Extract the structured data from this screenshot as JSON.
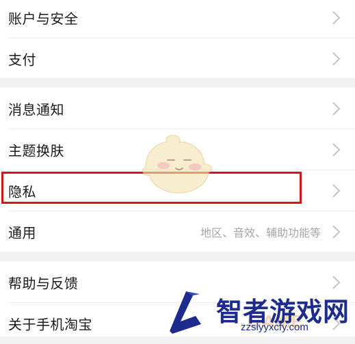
{
  "settings": {
    "items": [
      {
        "label": "账户与安全"
      },
      {
        "label": "支付"
      },
      {
        "label": "消息通知"
      },
      {
        "label": "主题换肤"
      },
      {
        "label": "隐私"
      },
      {
        "label": "通用",
        "sub": "地区、音效、辅助功能等"
      },
      {
        "label": "帮助与反馈"
      },
      {
        "label": "关于手机淘宝"
      }
    ]
  },
  "watermark": {
    "title": "智者游戏网",
    "url": "zzslyyxcfy.com",
    "ghost": "GAME"
  },
  "colors": {
    "highlight": "#d01818",
    "watermark": "#1d2c8c",
    "separator": "#f2f2f2"
  },
  "icons": {
    "chevron": "chevron-right-icon",
    "mascot": "mascot-sticker",
    "logo": "watermark-logo"
  }
}
